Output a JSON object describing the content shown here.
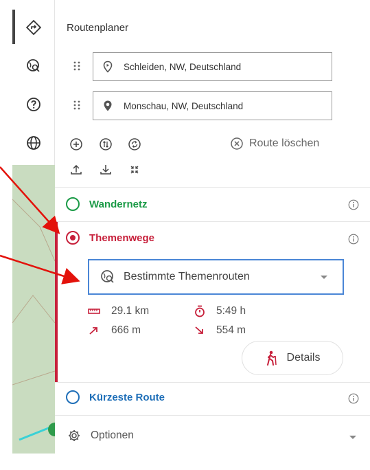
{
  "panel": {
    "title": "Routenplaner"
  },
  "waypoints": [
    {
      "value": "Schleiden, NW, Deutschland"
    },
    {
      "value": "Monschau, NW, Deutschland"
    }
  ],
  "actions": {
    "clear_route": "Route löschen"
  },
  "sections": {
    "wandernetz": {
      "label": "Wandernetz",
      "color": "#1a9a46"
    },
    "themenwege": {
      "label": "Themenwege",
      "color": "#c7203b"
    },
    "kuerzeste": {
      "label": "Kürzeste Route",
      "color": "#1f6fb8"
    }
  },
  "themen_select": {
    "selected": "Bestimmte Themenrouten"
  },
  "stats": {
    "distance": "29.1 km",
    "duration": "5:49 h",
    "ascent": "666 m",
    "descent": "554 m"
  },
  "details_button": {
    "label": "Details"
  },
  "options": {
    "label": "Optionen"
  },
  "colors": {
    "accent_red": "#c7203b",
    "select_border": "#4a86d6",
    "annotation_arrow": "#e3120b"
  }
}
